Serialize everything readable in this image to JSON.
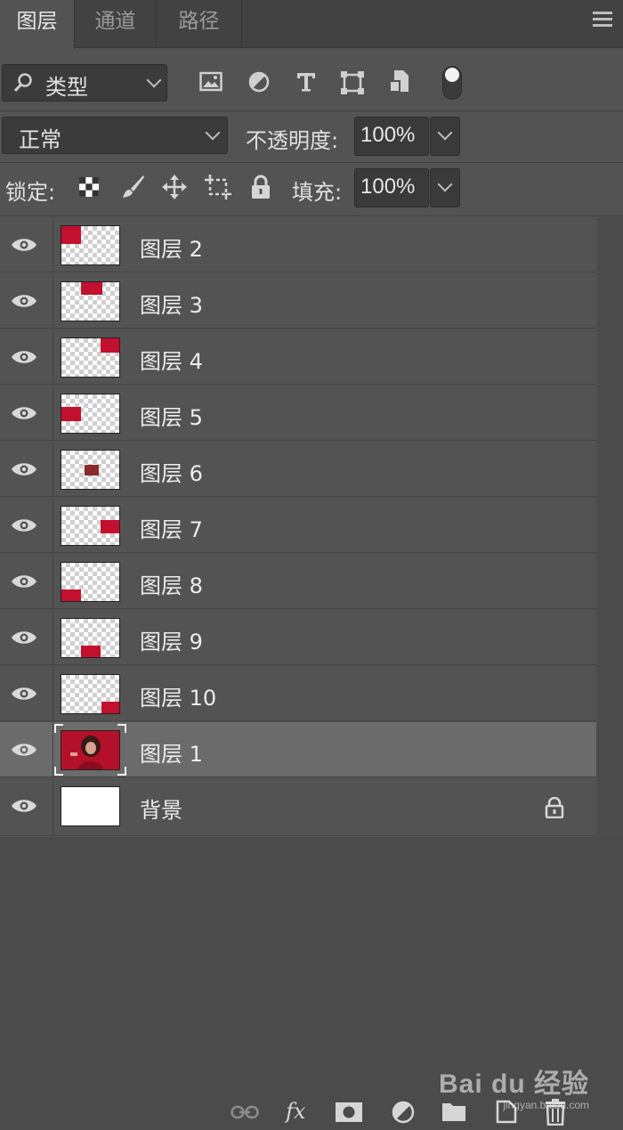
{
  "tabs": [
    {
      "label": "图层",
      "active": true
    },
    {
      "label": "通道",
      "active": false
    },
    {
      "label": "路径",
      "active": false
    }
  ],
  "filter": {
    "kind_label": "类型",
    "icons": [
      "image-filter-icon",
      "adjustment-filter-icon",
      "type-filter-icon",
      "shape-filter-icon",
      "smart-object-filter-icon",
      "filter-toggle-icon"
    ]
  },
  "blend": {
    "mode": "正常",
    "opacity_label": "不透明度:",
    "opacity_value": "100%"
  },
  "lock": {
    "label": "锁定:",
    "icons": [
      "lock-transparent-pixels-icon",
      "lock-image-pixels-icon",
      "lock-position-icon",
      "lock-artboard-icon",
      "lock-all-icon"
    ],
    "fill_label": "填充:",
    "fill_value": "100%"
  },
  "layers": [
    {
      "name": "图层 2",
      "visible": true,
      "selected": false
    },
    {
      "name": "图层 3",
      "visible": true,
      "selected": false
    },
    {
      "name": "图层 4",
      "visible": true,
      "selected": false
    },
    {
      "name": "图层 5",
      "visible": true,
      "selected": false
    },
    {
      "name": "图层 6",
      "visible": true,
      "selected": false
    },
    {
      "name": "图层 7",
      "visible": true,
      "selected": false
    },
    {
      "name": "图层 8",
      "visible": true,
      "selected": false
    },
    {
      "name": "图层 9",
      "visible": true,
      "selected": false
    },
    {
      "name": "图层 10",
      "visible": true,
      "selected": false
    },
    {
      "name": "图层 1",
      "visible": true,
      "selected": true
    },
    {
      "name": "背景",
      "visible": true,
      "selected": false,
      "locked": true
    }
  ],
  "footer_icons": [
    "link-layers-icon",
    "fx-icon",
    "layer-mask-icon",
    "adjustment-layer-icon",
    "group-folder-icon",
    "new-layer-icon",
    "delete-layer-icon"
  ],
  "watermark": {
    "brand": "Bai du 经验",
    "url": "jingyan.baidu.com"
  },
  "colors": {
    "panel": "#535353",
    "tabbar": "#424242",
    "selected_row": "#6b6b6b",
    "accent_red": "#c4102f"
  }
}
